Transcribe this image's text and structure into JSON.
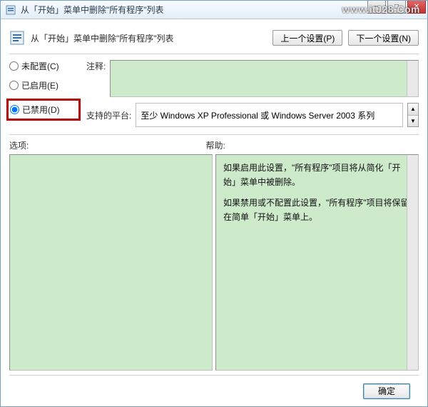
{
  "window": {
    "title": "从「开始」菜单中删除\"所有程序\"列表"
  },
  "watermark": "www.itJ28.Com",
  "header": {
    "title": "从「开始」菜单中删除\"所有程序\"列表",
    "prev_btn": "上一个设置(P)",
    "next_btn": "下一个设置(N)"
  },
  "radios": {
    "not_configured": "未配置(C)",
    "enabled": "已启用(E)",
    "disabled": "已禁用(D)",
    "selected": "disabled"
  },
  "comment": {
    "label": "注释:"
  },
  "platform": {
    "label": "支持的平台:",
    "value": "至少 Windows XP Professional 或 Windows Server 2003 系列"
  },
  "sections": {
    "options": "选项:",
    "help": "帮助:"
  },
  "help_text": {
    "p1": "如果启用此设置，\"所有程序\"项目将从简化「开始」菜单中被删除。",
    "p2": "如果禁用或不配置此设置，\"所有程序\"项目将保留在简单「开始」菜单上。"
  },
  "footer": {
    "ok": "确定"
  },
  "win_controls": {
    "min": "─",
    "max": "□",
    "close": "✕"
  },
  "icons": {
    "title_icon": "policy-icon",
    "head_icon": "policy-icon"
  },
  "colors": {
    "greenfill": "#cdeacb",
    "highlight": "#b40000"
  }
}
